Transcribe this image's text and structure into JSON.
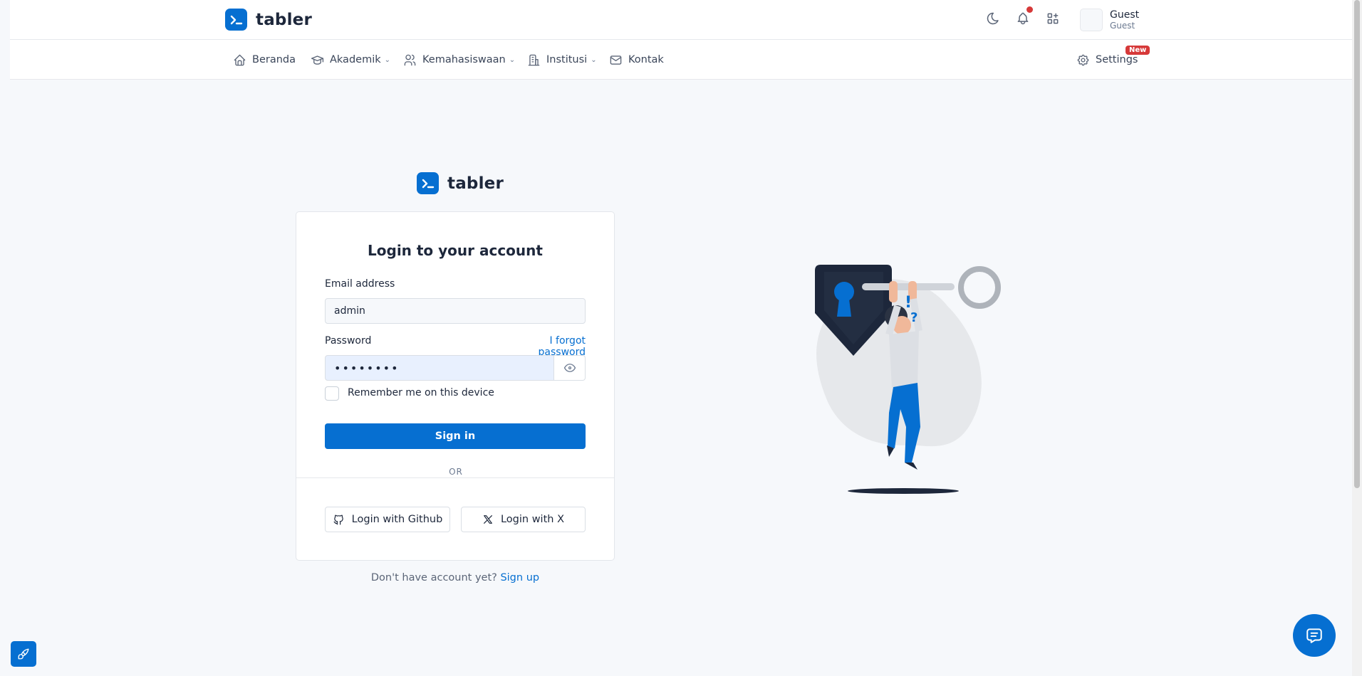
{
  "brand": {
    "name": "tabler"
  },
  "colors": {
    "primary": "#066fd1",
    "danger": "#d63939",
    "background": "#f6f8fb"
  },
  "topbar": {
    "icons": [
      "moon-icon",
      "bell-icon",
      "apps-icon"
    ],
    "user": {
      "name": "Guest",
      "role": "Guest"
    }
  },
  "nav": {
    "items": [
      {
        "label": "Beranda",
        "icon": "home-icon",
        "dropdown": false
      },
      {
        "label": "Akademik",
        "icon": "school-icon",
        "dropdown": true
      },
      {
        "label": "Kemahasiswaan",
        "icon": "users-icon",
        "dropdown": true
      },
      {
        "label": "Institusi",
        "icon": "building-icon",
        "dropdown": true
      },
      {
        "label": "Kontak",
        "icon": "mail-icon",
        "dropdown": false
      }
    ],
    "settings": {
      "label": "Settings",
      "badge": "New",
      "icon": "gear-icon"
    }
  },
  "login": {
    "title": "Login to your account",
    "email_label": "Email address",
    "email_value": "admin",
    "password_label": "Password",
    "forgot_label": "I forgot password",
    "password_value": "••••••••",
    "remember_label": "Remember me on this device",
    "signin_label": "Sign in",
    "or_label": "OR",
    "github_label": "Login with Github",
    "x_label": "Login with X",
    "signup_prompt": "Don't have account yet?",
    "signup_link": "Sign up"
  }
}
